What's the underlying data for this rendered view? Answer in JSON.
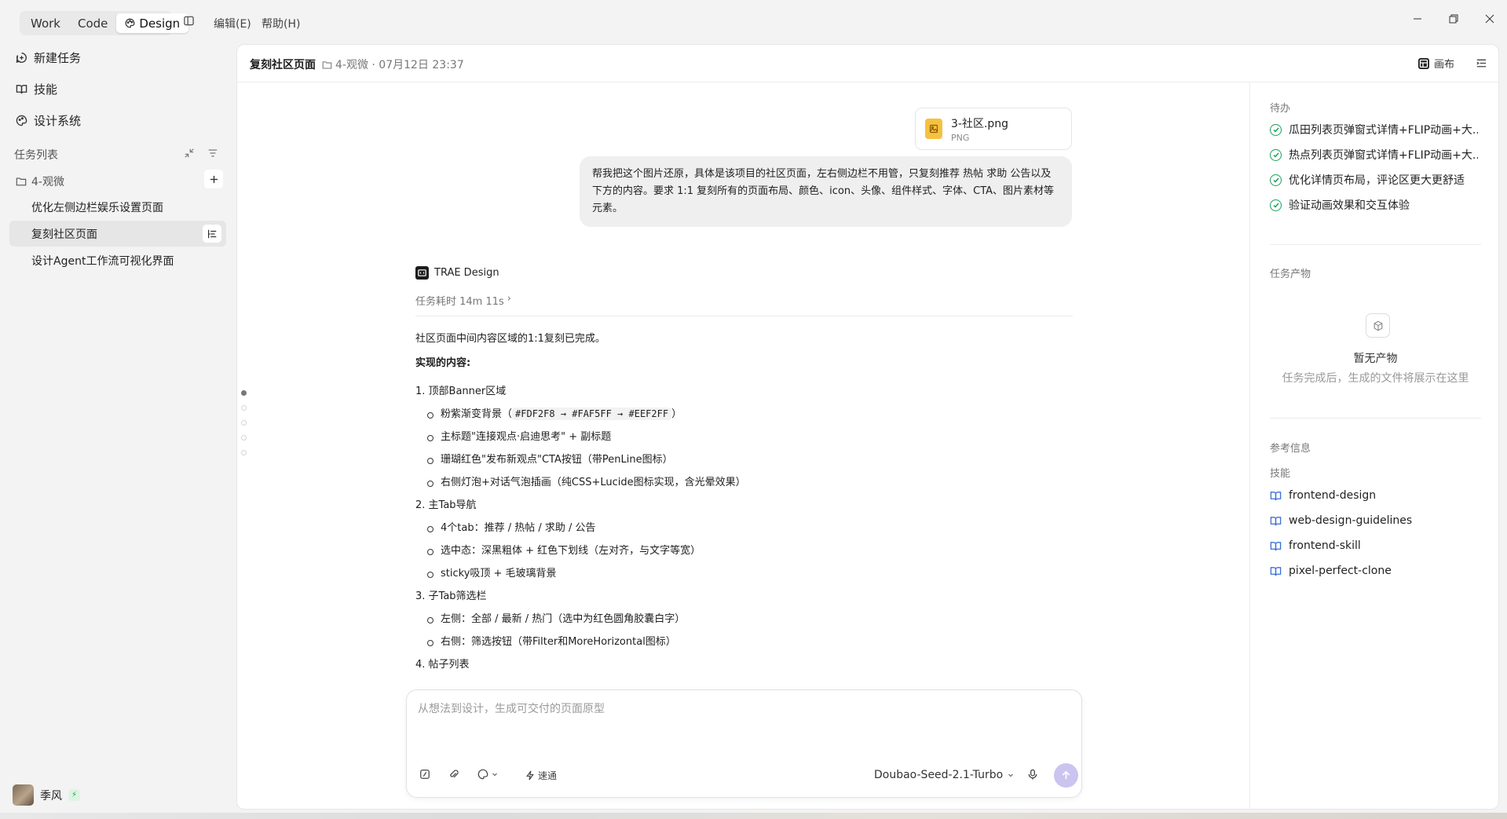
{
  "titlebar": {
    "modes": [
      "Work",
      "Code",
      "Design"
    ],
    "menu": [
      "编辑(E)",
      "帮助(H)"
    ]
  },
  "sidebar": {
    "nav": [
      "新建任务",
      "技能",
      "设计系统"
    ],
    "section_title": "任务列表",
    "folder": "4-观微",
    "tasks": [
      "优化左侧边栏娱乐设置页面",
      "复刻社区页面",
      "设计Agent工作流可视化界面"
    ],
    "user": "季风"
  },
  "header": {
    "title": "复刻社区页面",
    "meta": "4-观微 · 07月12日 23:37",
    "canvas": "画布"
  },
  "chat": {
    "attachment": {
      "name": "3-社区.png",
      "type": "PNG"
    },
    "user_message": "帮我把这个图片还原，具体是该项目的社区页面，左右侧边栏不用管，只复刻推荐 热帖 求助 公告以及下方的内容。要求 1:1 复刻所有的页面布局、颜色、icon、头像、组件样式、字体、CTA、图片素材等元素。",
    "agent_name": "TRAE Design",
    "duration": "任务耗时 14m 11s",
    "reply": {
      "intro": "社区页面中间内容区域的1:1复刻已完成。",
      "heading": "实现的内容:",
      "s1": "1. 顶部Banner区域",
      "s1a_pre": "粉紫渐变背景（",
      "s1a_code": "#FDF2F8 → #FAF5FF → #EEF2FF",
      "s1a_post": "）",
      "s1b": "主标题\"连接观点·启迪思考\" + 副标题",
      "s1c": "珊瑚红色\"发布新观点\"CTA按钮（带PenLine图标）",
      "s1d": "右侧灯泡+对话气泡插画（纯CSS+Lucide图标实现，含光晕效果）",
      "s2": "2. 主Tab导航",
      "s2a": "4个tab：推荐 / 热帖 / 求助 / 公告",
      "s2b": "选中态：深黑粗体 + 红色下划线（左对齐，与文字等宽）",
      "s2c": "sticky吸顶 + 毛玻璃背景",
      "s3": "3. 子Tab筛选栏",
      "s3a": "左侧：全部 / 最新 / 热门（选中为红色圆角胶囊白字）",
      "s3b": "右侧：筛选按钮（带Filter和MoreHorizontal图标）",
      "s4": "4. 帖子列表"
    }
  },
  "composer": {
    "placeholder": "从想法到设计，生成可交付的页面原型",
    "speed": "速通",
    "model": "Doubao-Seed-2.1-Turbo"
  },
  "panel": {
    "todo_title": "待办",
    "todos": [
      "瓜田列表页弹窗式详情+FLIP动画+大...",
      "热点列表页弹窗式详情+FLIP动画+大...",
      "优化详情页布局，评论区更大更舒适",
      "验证动画效果和交互体验"
    ],
    "artifacts_title": "任务产物",
    "empty_title": "暂无产物",
    "empty_sub": "任务完成后，生成的文件将展示在这里",
    "ref_title": "参考信息",
    "skills_title": "技能",
    "skills": [
      "frontend-design",
      "web-design-guidelines",
      "frontend-skill",
      "pixel-perfect-clone"
    ]
  },
  "colors": {
    "accent_check": "#1aa05b",
    "skill_icon": "#3b6fd8",
    "send_button": "#cbc4f0",
    "file_icon": "#f6c141"
  }
}
